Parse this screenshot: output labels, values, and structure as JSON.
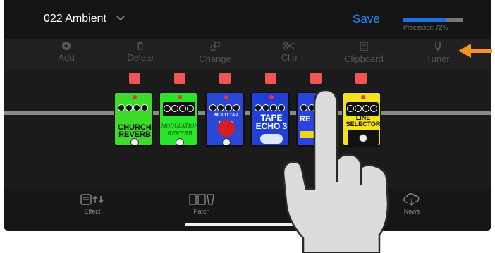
{
  "header": {
    "preset_name": "022 Ambient",
    "save_label": "Save",
    "processor_text": "Processor: 72%",
    "processor_fraction": 0.72,
    "accent": "#1e88ff"
  },
  "toolbar": {
    "add": "Add",
    "delete": "Delete",
    "change": "Change",
    "clip": "Clip",
    "clipboard": "Clipboard",
    "tuner": "Tuner"
  },
  "pedals": [
    {
      "line1": "CHURCH",
      "line2": "REVERB",
      "color": "#3ddc2a"
    },
    {
      "line1": "MODULATION",
      "line2": "REVERB",
      "color": "#2be52b"
    },
    {
      "line1": "MULTI TAP DELAY",
      "line2": "",
      "color": "#2a47d6"
    },
    {
      "line1": "TAPE",
      "line2": "ECHO 3",
      "color": "#1f3fd8"
    },
    {
      "line1": "RE",
      "line2": "E",
      "color": "#2a44e0"
    },
    {
      "line1": "LINE",
      "line2": "SELECTOR",
      "color": "#f4e21a"
    }
  ],
  "tabs": {
    "effect": "Effect",
    "patch": "Patch",
    "news": "News"
  },
  "colors": {
    "bypass": "#f25555",
    "highlight_arrow": "#f7931e"
  }
}
